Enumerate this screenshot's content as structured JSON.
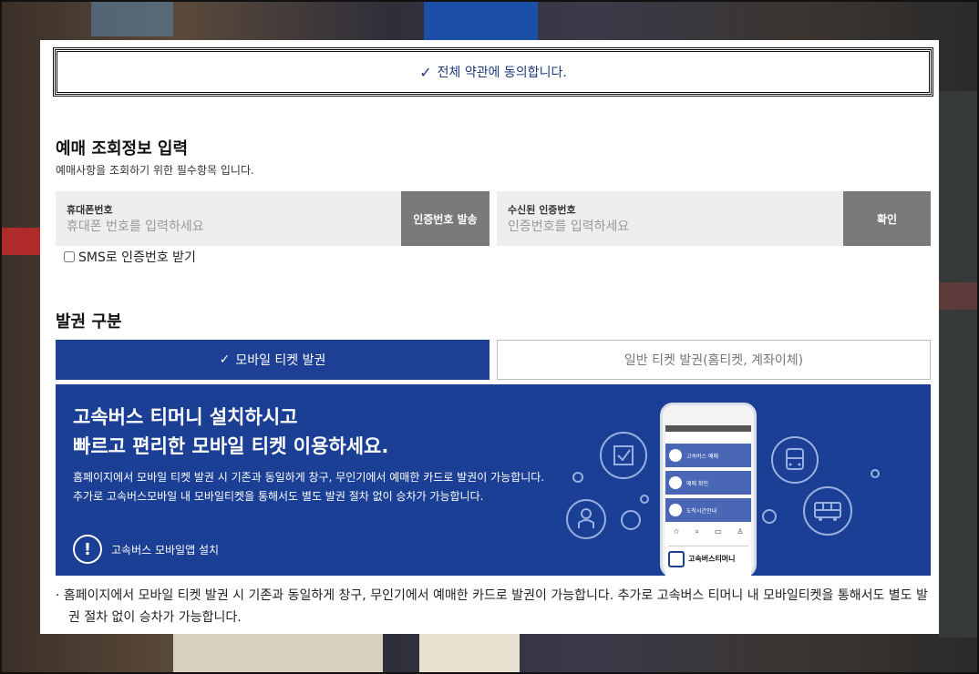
{
  "agree": {
    "check": "✓",
    "label": "전체 약관에 동의합니다."
  },
  "inquiry": {
    "title": "예매 조회정보 입력",
    "desc": "예매사항을 조회하기 위한 필수항목 입니다.",
    "phone": {
      "label": "휴대폰번호",
      "placeholder": "휴대폰 번호를 입력하세요",
      "value": ""
    },
    "send_button": "인증번호 발송",
    "code": {
      "label": "수신된 인증번호",
      "placeholder": "인증번호를 입력하세요",
      "value": ""
    },
    "confirm_button": "확인",
    "sms_checkbox": {
      "label": "SMS로 인증번호 받기",
      "checked": false
    }
  },
  "issue": {
    "title": "발권 구분",
    "tabs": [
      {
        "label": "모바일 티켓 발권",
        "check": "✓",
        "active": true
      },
      {
        "label": "일반 티켓 발권(홈티켓, 계좌이체)",
        "active": false
      }
    ]
  },
  "banner": {
    "headline_1": "고속버스 티머니 설치하시고",
    "headline_2": "빠르고 편리한 모바일 티켓 이용하세요.",
    "body": "홈페이지에서 모바일 티켓 발권 시 기존과 동일하게 창구, 무인기에서 예매한 카드로 발권이 가능합니다. 추가로 고속버스모바일 내 모바일티켓을 통해서도 별도 발권 절차 없이 승차가 가능합니다.",
    "install_mark": "!",
    "install_label": "고속버스 모바일앱 설치",
    "phone_app": {
      "rows": [
        "고속버스 예매",
        "예매 확인",
        "도착시간안내"
      ],
      "app_name": "고속버스티머니"
    },
    "colors": {
      "background": "#1a3f95",
      "accent": "#9ab0e0"
    }
  },
  "note": {
    "bullet": "·",
    "text": "홈페이지에서 모바일 티켓 발권 시 기존과 동일하게 창구, 무인기에서 예매한 카드로 발권이 가능합니다. 추가로 고속버스 티머니 내 모바일티켓을 통해서도 별도 발권 절차 없이 승차가 가능합니다."
  }
}
